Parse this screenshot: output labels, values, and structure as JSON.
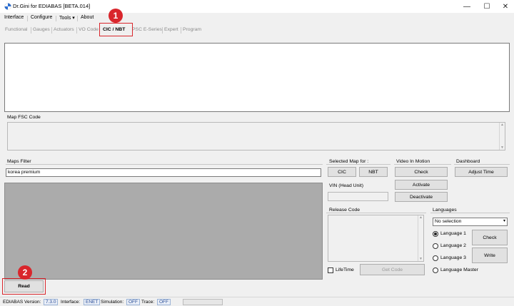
{
  "window": {
    "title": "Dr.Gini for EDIABAS [BETA.014]",
    "minimize": "—",
    "maximize": "☐",
    "close": "✕"
  },
  "menu": [
    "Interface",
    "Configure",
    "Tools ▾",
    "About"
  ],
  "tabs": [
    "Functional",
    "Gauges",
    "Actuators",
    "VO Code",
    "CIC / NBT",
    "PSC E-Series",
    "Expert",
    "Program"
  ],
  "callouts": {
    "one": "1",
    "two": "2"
  },
  "map_fsc": {
    "label": "Map FSC Code"
  },
  "maps_filter": {
    "label": "Maps Filter",
    "value": "korea premium"
  },
  "selected_map": {
    "label": "Selected Map for :",
    "cic": "CIC",
    "nbt": "NBT"
  },
  "vin": {
    "label": "VIN (Head Unit)"
  },
  "video_in_motion": {
    "label": "Video In Motion",
    "check": "Check",
    "activate": "Activate",
    "deactivate": "Deactivate"
  },
  "dashboard": {
    "label": "Dashboard",
    "adjust_time": "Adjust Time"
  },
  "release_code": {
    "label": "Release Code",
    "lifetime": "LifeTime",
    "get_code": "Get Code"
  },
  "languages": {
    "label": "Languages",
    "select_value": "No selection",
    "options": [
      "Language 1",
      "Language 2",
      "Language 3",
      "Language Master"
    ],
    "check": "Check",
    "write": "Write"
  },
  "read_button": "Read",
  "status": {
    "ediabas_label": "EDIABAS Version:",
    "ediabas_value": "7.3.0",
    "interface_label": "Interface:",
    "interface_value": "ENET",
    "simulation_label": "Simulation:",
    "simulation_value": "OFF",
    "trace_label": "Trace:",
    "trace_value": "OFF"
  }
}
